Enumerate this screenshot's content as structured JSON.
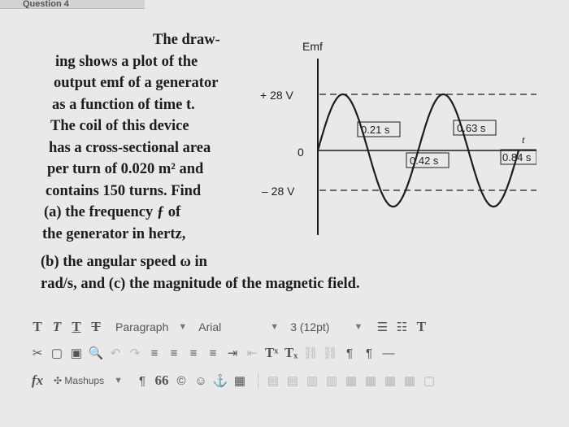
{
  "header": {
    "tab_label": "Question 4"
  },
  "problem": {
    "lines": [
      "The draw-",
      "ing shows a plot of the",
      "output emf of a generator",
      "as a function of time t.",
      "The coil of this device",
      "has a cross-sectional area",
      "per turn of 0.020 m² and",
      "contains 150 turns. Find",
      "(a) the frequency ƒ of",
      "the generator in hertz,"
    ],
    "bottom_lines": [
      "(b) the angular speed ω in",
      "rad/s, and  (c) the magnitude of the magnetic field."
    ]
  },
  "figure": {
    "ylabel": "Emf",
    "xlabel": "t",
    "ytick_top": "+ 28 V",
    "ytick_zero": "0",
    "ytick_bottom": "– 28 V",
    "t_labels": [
      "0.21 s",
      "0.42 s",
      "0.63 s",
      "0.84 s"
    ]
  },
  "chart_data": {
    "type": "line",
    "xlabel": "t",
    "ylabel": "Emf",
    "x": [
      0,
      0.105,
      0.21,
      0.315,
      0.42,
      0.525,
      0.63,
      0.735,
      0.84
    ],
    "y": [
      0,
      28,
      0,
      -28,
      0,
      28,
      0,
      -28,
      0
    ],
    "ylim": [
      -28,
      28
    ],
    "xticks": [
      "0.21 s",
      "0.42 s",
      "0.63 s",
      "0.84 s"
    ],
    "yticks": [
      "+ 28 V",
      "0",
      "– 28 V"
    ]
  },
  "toolbar": {
    "format_t1": "T",
    "format_t2": "T",
    "format_t3": "T",
    "format_t4": "T",
    "paragraph_label": "Paragraph",
    "font_label": "Arial",
    "size_label": "3 (12pt)",
    "mashups_label": "Mashups",
    "superscript_label": "Tˣ",
    "subscript_label": "Tₓ",
    "fx_label": "fx",
    "quote_label": "66",
    "t_color_label": "T"
  }
}
